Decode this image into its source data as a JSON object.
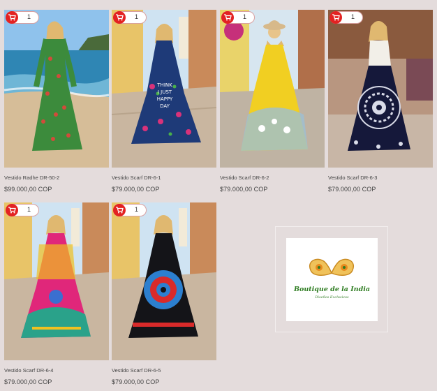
{
  "products": [
    {
      "title": "Vestido Radhe DR-50-2",
      "price": "$99.000,00 COP",
      "qty": "1"
    },
    {
      "title": "Vestido Scarf DR-6-1",
      "price": "$79.000,00 COP",
      "qty": "1"
    },
    {
      "title": "Vestido Scarf DR-6-2",
      "price": "$79.000,00 COP",
      "qty": "1"
    },
    {
      "title": "Vestido Scarf DR-6-3",
      "price": "$79.000,00 COP",
      "qty": "1"
    },
    {
      "title": "Vestido Scarf DR-6-4",
      "price": "$79.000,00 COP",
      "qty": "1"
    },
    {
      "title": "Vestido Scarf DR-6-5",
      "price": "$79.000,00 COP",
      "qty": "1"
    }
  ],
  "dress_prints": {
    "p1": [
      "THINK",
      "I JUST",
      "HAPPY",
      "DAY"
    ]
  },
  "brand": {
    "name": "Boutique de la India",
    "tagline": "Diseños Exclusivos"
  },
  "colors": {
    "cart_red": "#e32222",
    "brand_green": "#2f7d22",
    "page_bg": "#e4dcdc"
  },
  "icons": {
    "cart": "cart-icon"
  }
}
